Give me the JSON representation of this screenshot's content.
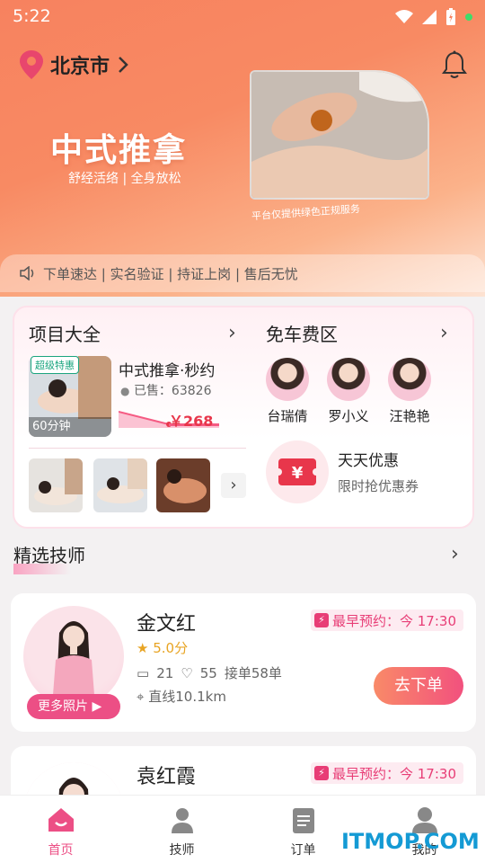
{
  "status_bar": {
    "time": "5:22"
  },
  "location": {
    "city": "北京市"
  },
  "banner": {
    "title": "中式推拿",
    "subtitle": "舒经活络 | 全身放松",
    "caption": "平台仅提供绿色正规服务"
  },
  "notice": {
    "items": "下单速达 | 实名验证 | 持证上岗 | 售后无忧"
  },
  "projects": {
    "title": "项目大全",
    "promo": {
      "badge": "超级特惠",
      "duration": "60分钟",
      "name": "中式推拿·秒约",
      "sold": "已售：63826",
      "price": "￥268"
    }
  },
  "free_area": {
    "title": "免车费区",
    "technicians": [
      {
        "name": "台瑞倩"
      },
      {
        "name": "罗小义"
      },
      {
        "name": "汪艳艳"
      }
    ],
    "coupon": {
      "title": "天天优惠",
      "subtitle": "限时抢优惠券"
    }
  },
  "featured": {
    "title": "精选技师",
    "cards": [
      {
        "name": "金文红",
        "earliest": "最早预约：今 17:30",
        "rating": "5.0分",
        "comments": "21",
        "likes": "55",
        "orders": "接单58单",
        "distance": "直线10.1km",
        "more_photos": "更多照片",
        "order_button": "去下单"
      },
      {
        "name": "袁红霞",
        "earliest": "最早预约：今 17:30"
      }
    ]
  },
  "tabbar": {
    "items": [
      {
        "label": "首页"
      },
      {
        "label": "技师"
      },
      {
        "label": "订单"
      },
      {
        "label": "我的"
      }
    ]
  },
  "watermark": "ITMOP.COM",
  "colors": {
    "accent": "#ec4f85",
    "price": "#e8364b",
    "hero": "#f7825f"
  }
}
